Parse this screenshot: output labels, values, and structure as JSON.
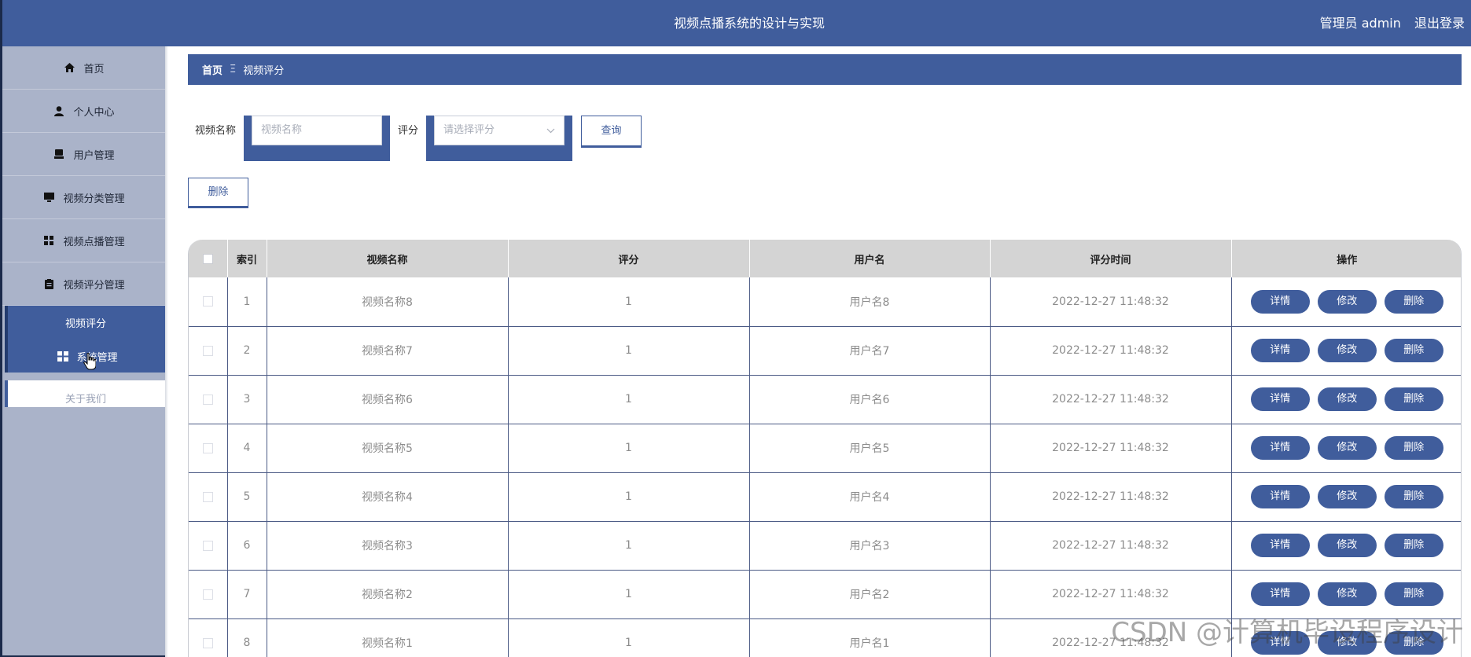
{
  "header": {
    "title": "视频点播系统的设计与实现",
    "user": "管理员 admin",
    "logout": "退出登录"
  },
  "sidebar": {
    "items": [
      {
        "label": "首页",
        "icon": "home-icon"
      },
      {
        "label": "个人中心",
        "icon": "user-icon"
      },
      {
        "label": "用户管理",
        "icon": "users-icon"
      },
      {
        "label": "视频分类管理",
        "icon": "monitor-icon"
      },
      {
        "label": "视频点播管理",
        "icon": "grid-icon"
      },
      {
        "label": "视频评分管理",
        "icon": "clipboard-icon"
      }
    ],
    "sub_active": "视频评分",
    "system_label": "系统管理",
    "about_label": "关于我们"
  },
  "breadcrumb": {
    "home": "首页",
    "separator": "Ξ",
    "current": "视频评分"
  },
  "search": {
    "name_label": "视频名称",
    "name_placeholder": "视频名称",
    "score_label": "评分",
    "score_placeholder": "请选择评分",
    "query_label": "查询"
  },
  "actions": {
    "delete_label": "删除"
  },
  "table": {
    "headers": [
      "索引",
      "视频名称",
      "评分",
      "用户名",
      "评分时间",
      "操作"
    ],
    "rows": [
      {
        "index": "1",
        "name": "视频名称8",
        "score": "1",
        "user": "用户名8",
        "time": "2022-12-27 11:48:32"
      },
      {
        "index": "2",
        "name": "视频名称7",
        "score": "1",
        "user": "用户名7",
        "time": "2022-12-27 11:48:32"
      },
      {
        "index": "3",
        "name": "视频名称6",
        "score": "1",
        "user": "用户名6",
        "time": "2022-12-27 11:48:32"
      },
      {
        "index": "4",
        "name": "视频名称5",
        "score": "1",
        "user": "用户名5",
        "time": "2022-12-27 11:48:32"
      },
      {
        "index": "5",
        "name": "视频名称4",
        "score": "1",
        "user": "用户名4",
        "time": "2022-12-27 11:48:32"
      },
      {
        "index": "6",
        "name": "视频名称3",
        "score": "1",
        "user": "用户名3",
        "time": "2022-12-27 11:48:32"
      },
      {
        "index": "7",
        "name": "视频名称2",
        "score": "1",
        "user": "用户名2",
        "time": "2022-12-27 11:48:32"
      },
      {
        "index": "8",
        "name": "视频名称1",
        "score": "1",
        "user": "用户名1",
        "time": "2022-12-27 11:48:32"
      }
    ],
    "row_actions": {
      "detail": "详情",
      "edit": "修改",
      "delete": "删除"
    }
  },
  "watermark": "CSDN @计算机毕设程序设计",
  "colors": {
    "primary": "#405d9c",
    "sidebar": "#aab3c9",
    "header_row": "#d4d4d4"
  }
}
